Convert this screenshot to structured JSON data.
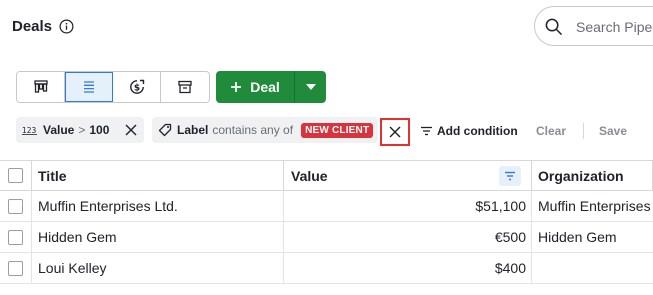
{
  "header": {
    "title": "Deals",
    "search_placeholder": "Search Pipedrive"
  },
  "toolbar": {
    "view_buttons": [
      {
        "name": "pipeline-view",
        "icon": "kanban-icon",
        "active": false
      },
      {
        "name": "list-view",
        "icon": "list-icon",
        "active": true
      },
      {
        "name": "forecast-view",
        "icon": "forecast-icon",
        "active": false
      },
      {
        "name": "archive-view",
        "icon": "archive-icon",
        "active": false
      }
    ],
    "add_deal_label": "Deal",
    "add_deal_icon": "plus-icon"
  },
  "filters": {
    "conditions": [
      {
        "icon": "number-icon",
        "field": "Value",
        "operator": ">",
        "value": "100"
      },
      {
        "icon": "tag-icon",
        "field": "Label",
        "operator": "contains any of",
        "value": "NEW CLIENT",
        "value_color": "#d8343d"
      }
    ],
    "add_condition_label": "Add condition",
    "clear_label": "Clear",
    "save_label": "Save"
  },
  "table": {
    "columns": [
      "Title",
      "Value",
      "Organization"
    ],
    "sorted_column": "Value",
    "rows": [
      {
        "title": "Muffin Enterprises Ltd.",
        "value": "$51,100",
        "organization": "Muffin Enterprises Ltd."
      },
      {
        "title": "Hidden Gem",
        "value": "€500",
        "organization": "Hidden Gem"
      },
      {
        "title": "Loui Kelley",
        "value": "$400",
        "organization": ""
      }
    ]
  },
  "colors": {
    "primary_green": "#1f8b3b",
    "active_blue": "#317ae2",
    "label_red": "#d8343d",
    "highlight_red": "#e0332f"
  }
}
